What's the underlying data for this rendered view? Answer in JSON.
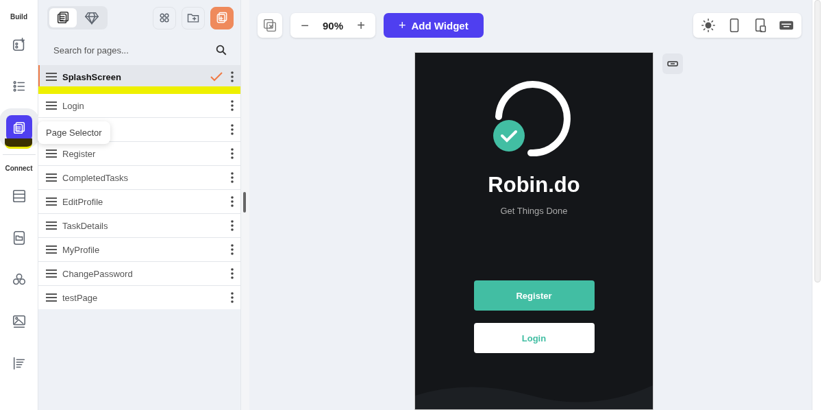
{
  "rail": {
    "sections": [
      {
        "label": "Build",
        "items": [
          {
            "selected": false
          },
          {
            "selected": false
          },
          {
            "selected": true
          }
        ]
      },
      {
        "label": "Connect",
        "items": [
          {
            "selected": false
          },
          {
            "selected": false
          },
          {
            "selected": false
          },
          {
            "selected": false
          },
          {
            "selected": false
          }
        ]
      }
    ],
    "tooltip": "Page Selector"
  },
  "panel": {
    "tabs": [
      {
        "selected": true
      },
      {
        "selected": false
      }
    ],
    "actions": [
      {
        "primary": false
      },
      {
        "primary": false
      },
      {
        "primary": true
      }
    ],
    "search": {
      "placeholder": "Search for pages..."
    },
    "pages": [
      {
        "label": "SplashScreen",
        "selected": true
      },
      {
        "label": "Login",
        "selected": false
      },
      {
        "selected": false
      },
      {
        "label": "Register",
        "selected": false
      },
      {
        "label": "CompletedTasks",
        "selected": false
      },
      {
        "label": "EditProfile",
        "selected": false
      },
      {
        "label": "TaskDetails",
        "selected": false
      },
      {
        "label": "MyProfile",
        "selected": false
      },
      {
        "label": "ChangePassword",
        "selected": false
      },
      {
        "label": "testPage",
        "selected": false
      }
    ]
  },
  "toolbar": {
    "zoom": "90%",
    "zoom_out": "−",
    "zoom_in": "+",
    "add_widget": {
      "icon": "+",
      "label": "Add Widget"
    }
  },
  "phone": {
    "title": "Robin.do",
    "subtitle": "Get Things Done",
    "buttons": [
      {
        "label": "Register",
        "kind": "filled"
      },
      {
        "label": "Login",
        "kind": "outline"
      }
    ]
  }
}
